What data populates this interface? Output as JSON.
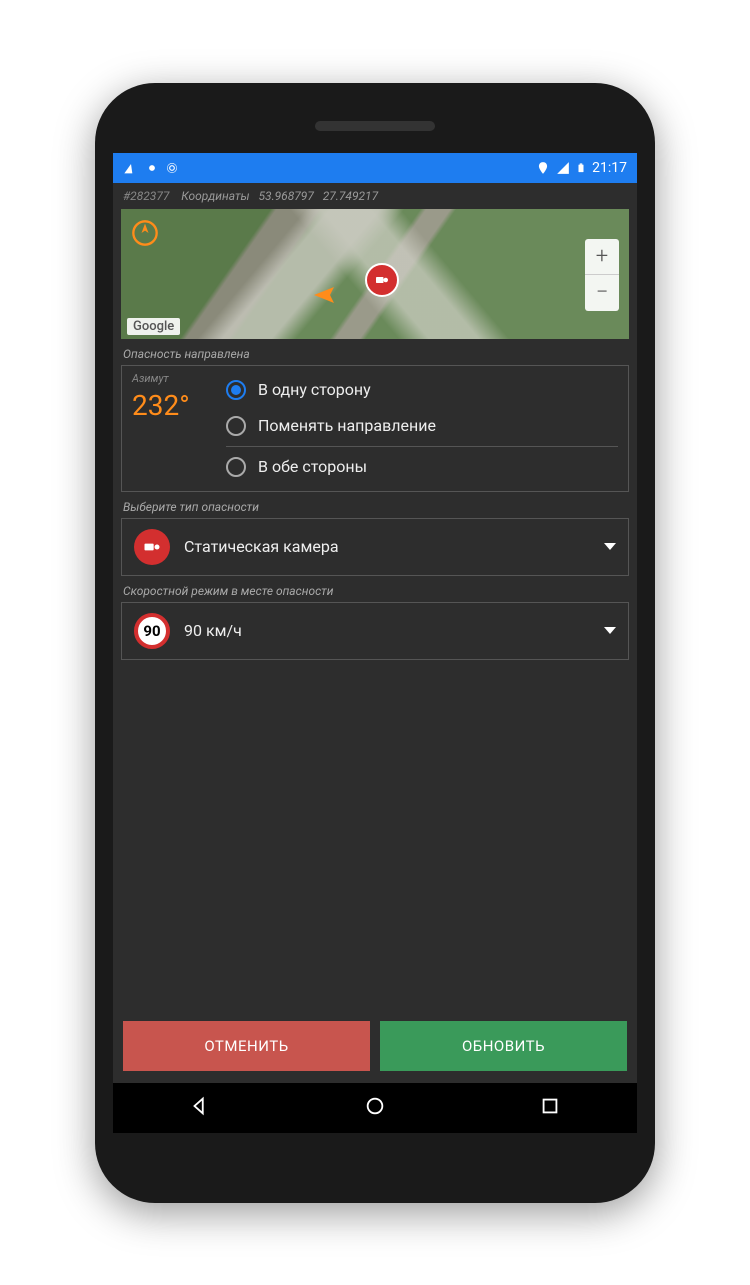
{
  "statusbar": {
    "time": "21:17"
  },
  "info": {
    "id": "#282377",
    "coords_label": "Координаты",
    "lat": "53.968797",
    "lon": "27.749217"
  },
  "map": {
    "attribution": "Google"
  },
  "direction": {
    "section_label": "Опасность направлена",
    "azimuth_label": "Азимут",
    "azimuth_value": "232°",
    "options": {
      "one_way": "В одну сторону",
      "swap": "Поменять направление",
      "both": "В обе стороны"
    }
  },
  "hazard_type": {
    "section_label": "Выберите тип опасности",
    "selected": "Статическая камера"
  },
  "speed_limit": {
    "section_label": "Скоростной режим в месте опасности",
    "selected_label": "90 км/ч",
    "selected_value": "90"
  },
  "buttons": {
    "cancel": "ОТМЕНИТЬ",
    "update": "ОБНОВИТЬ"
  }
}
